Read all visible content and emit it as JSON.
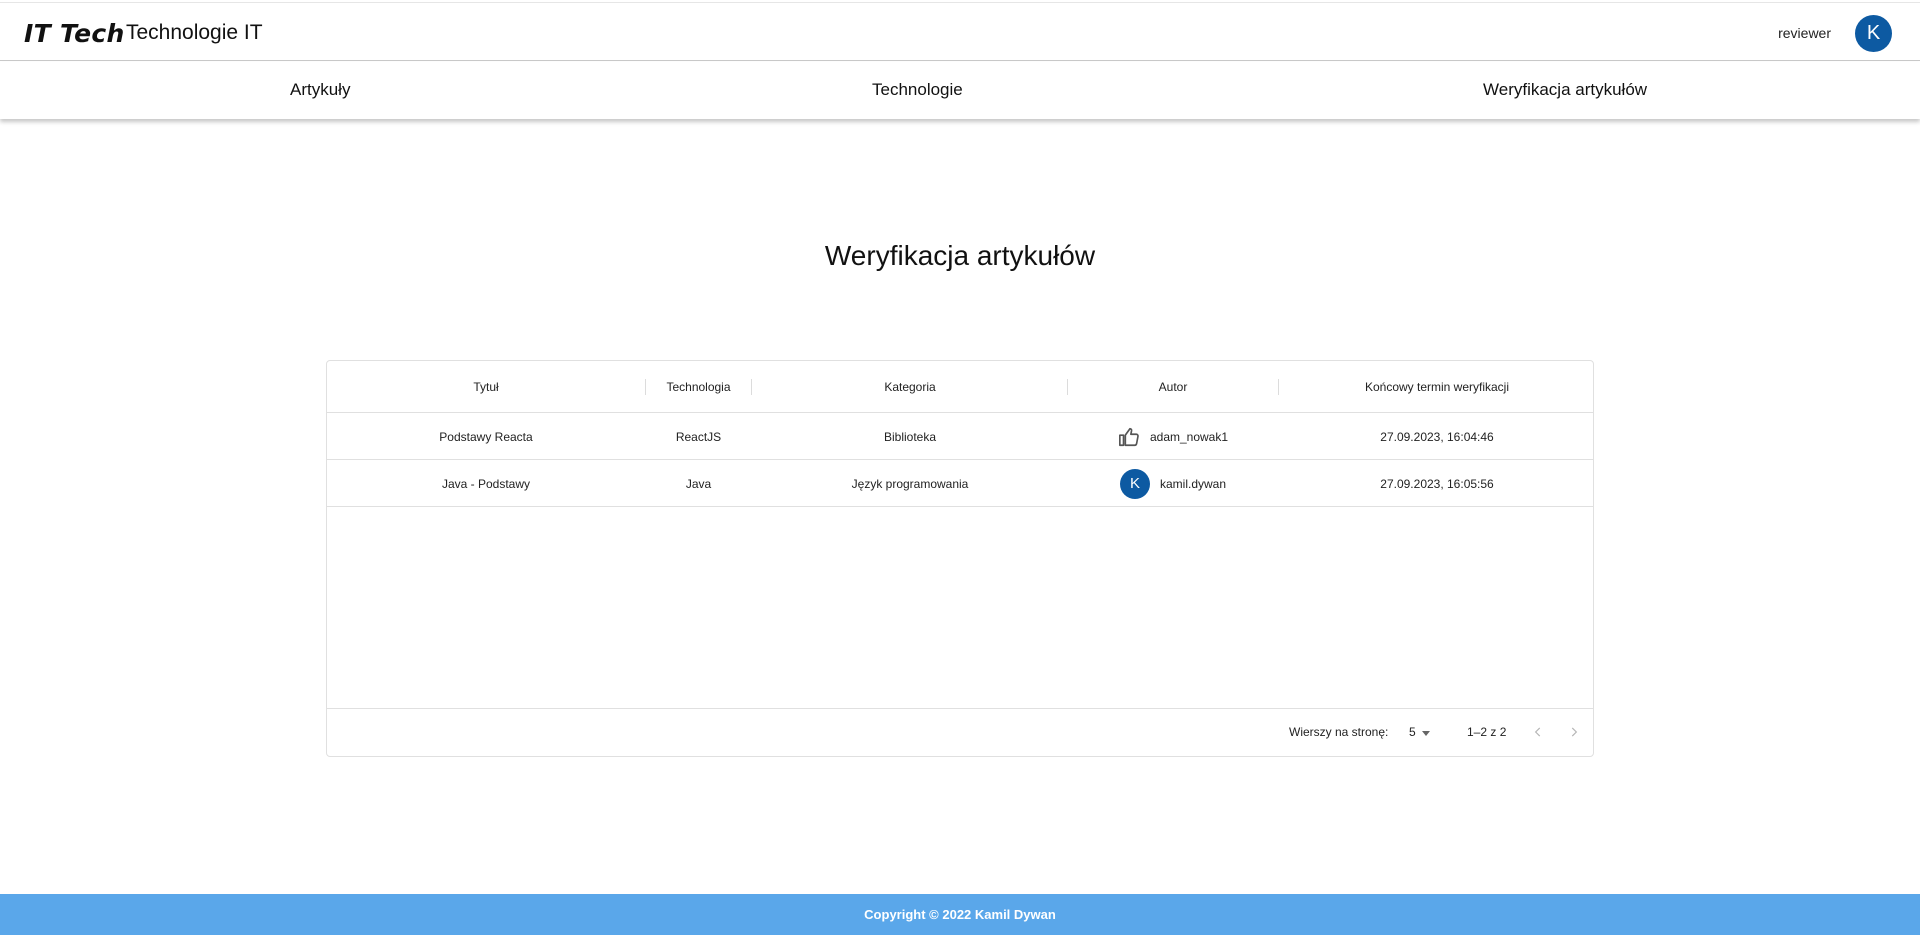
{
  "header": {
    "logo": "IT Tech",
    "title": "Technologie IT",
    "username": "reviewer",
    "avatar_initial": "K",
    "avatar_color": "#0d5aa2"
  },
  "nav": {
    "items": [
      {
        "label": "Artykuły"
      },
      {
        "label": "Technologie"
      },
      {
        "label": "Weryfikacja artykułów"
      }
    ]
  },
  "main": {
    "title": "Weryfikacja artykułów"
  },
  "table": {
    "columns": [
      "Tytuł",
      "Technologia",
      "Kategoria",
      "Autor",
      "Końcowy termin weryfikacji"
    ],
    "rows": [
      {
        "title": "Podstawy Reacta",
        "technology": "ReactJS",
        "category": "Biblioteka",
        "author": "adam_nowak1",
        "author_icon": "thumb-up-icon",
        "deadline": "27.09.2023, 16:04:46"
      },
      {
        "title": "Java - Podstawy",
        "technology": "Java",
        "category": "Język programowania",
        "author": "kamil.dywan",
        "author_avatar_initial": "K",
        "deadline": "27.09.2023, 16:05:56"
      }
    ],
    "pagination": {
      "rows_per_page_label": "Wierszy na stronę:",
      "rows_per_page_value": "5",
      "range_label": "1–2 z 2",
      "prev_icon": "chevron-left-icon",
      "next_icon": "chevron-right-icon"
    }
  },
  "footer": {
    "text": "Copyright © 2022 Kamil Dywan",
    "color": "#5aa7ea"
  }
}
